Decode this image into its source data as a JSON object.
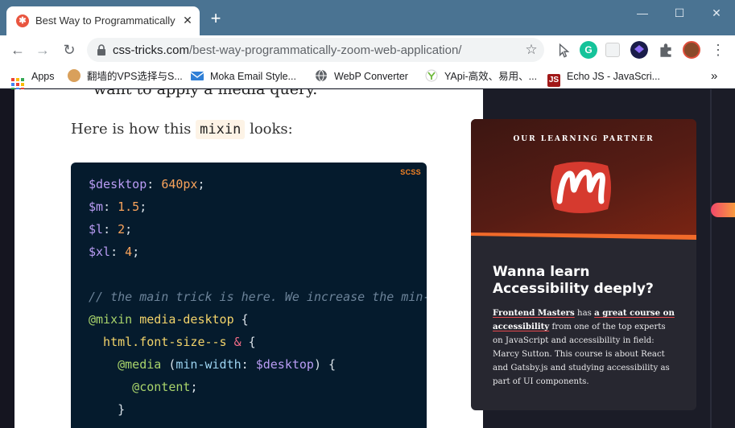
{
  "browser": {
    "tab": {
      "title": "Best Way to Programmatically",
      "close_glyph": "✕"
    },
    "new_tab_glyph": "+",
    "window_controls": {
      "minimize": "—",
      "maximize": "☐",
      "close": "✕"
    },
    "nav": {
      "back": "←",
      "forward": "→",
      "reload": "↻"
    },
    "url": {
      "host": "css-tricks.com",
      "path": "/best-way-programmatically-zoom-web-application/"
    },
    "bookmark_star": "☆",
    "bookmarks": [
      {
        "label": "Apps",
        "icon": "apps-grid-icon"
      },
      {
        "label": "翻墙的VPS选择与S...",
        "icon": "avatar-icon"
      },
      {
        "label": "Moka Email Style...",
        "icon": "mail-icon"
      },
      {
        "label": "WebP Converter",
        "icon": "globe-icon"
      },
      {
        "label": "YApi-高效、易用、...",
        "icon": "yapi-icon"
      },
      {
        "label": "Echo JS - JavaScri...",
        "icon": "echojs-icon"
      }
    ],
    "bookmarks_more": "»",
    "menu_glyph": "⋮"
  },
  "article": {
    "cut_line": "want to apply a media query.",
    "para_before": "Here is how this ",
    "para_code": "mixin",
    "para_after": " looks:",
    "code": {
      "language": "SCSS",
      "lines": {
        "l1_var": "$desktop",
        "l1_punc": ": ",
        "l1_num": "640px",
        "l1_end": ";",
        "l2_var": "$m",
        "l2_punc": ": ",
        "l2_num": "1.5",
        "l2_end": ";",
        "l3_var": "$l",
        "l3_punc": ": ",
        "l3_num": "2",
        "l3_end": ";",
        "l4_var": "$xl",
        "l4_punc": ": ",
        "l4_num": "4",
        "l4_end": ";",
        "l6_comment": "// the main trick is here. We increase the min-width",
        "l7_at": "@mixin",
        "l7_name": " media-desktop",
        "l7_brace": " {",
        "l8_name": "  html.font-size--s",
        "l8_amp": " &",
        "l8_brace": " {",
        "l9_at": "    @media",
        "l9_open": " (",
        "l9_prop": "min-width",
        "l9_colon": ": ",
        "l9_var": "$desktop",
        "l9_close": ") {",
        "l10_at": "      @content",
        "l10_end": ";",
        "l11_brace": "    }"
      }
    }
  },
  "ad": {
    "kicker": "OUR LEARNING PARTNER",
    "logo_letter": "M",
    "headline": "Wanna learn Accessibility deeply?",
    "body_link1": "Frontend Masters",
    "body_text1": " has ",
    "body_link2": "a great course on accessibility",
    "body_text2": " from one of the top experts on JavaScript and accessibility in field: Marcy Sutton. This course is about React and Gatsby.js and studying accessibility as part of UI components.",
    "colors": {
      "brand_red": "#c02d28",
      "band_orange": "#f16a2a"
    }
  }
}
